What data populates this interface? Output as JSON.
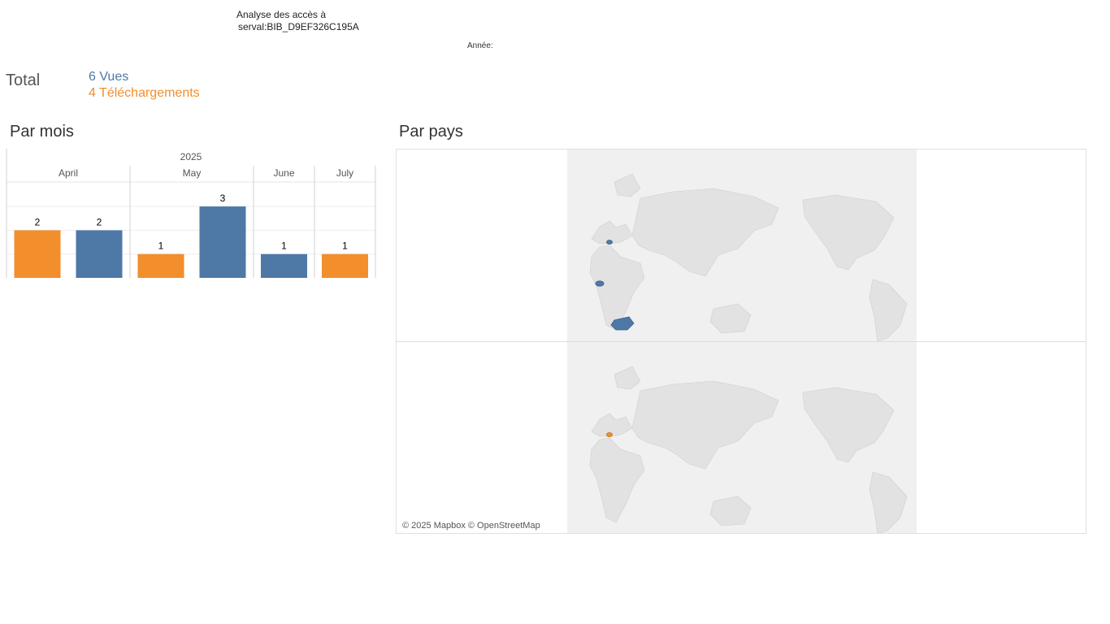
{
  "header": {
    "title_line1": "Analyse des accès à",
    "title_line2": "serval:BIB_D9EF326C195A",
    "year_filter_label": "Année:"
  },
  "totals": {
    "label": "Total",
    "views": "6 Vues",
    "downloads": "4 Téléchargements"
  },
  "sections": {
    "by_month": "Par mois",
    "by_country": "Par pays"
  },
  "colors": {
    "views": "#4e79a7",
    "downloads": "#f28e2b"
  },
  "chart_data": {
    "type": "bar",
    "year": "2025",
    "categories": [
      "April",
      "May",
      "June",
      "July"
    ],
    "series": [
      {
        "key": "downloads",
        "color": "#f28e2b",
        "values": [
          2,
          1,
          0,
          1
        ]
      },
      {
        "key": "views",
        "color": "#4e79a7",
        "values": [
          2,
          3,
          1,
          0
        ]
      }
    ],
    "ylim": [
      0,
      3
    ],
    "grid": true
  },
  "map": {
    "credit": "© 2025 Mapbox © OpenStreetMap",
    "views_countries": [
      "Switzerland",
      "Burkina Faso",
      "South Africa"
    ],
    "downloads_countries": [
      "Switzerland"
    ]
  }
}
